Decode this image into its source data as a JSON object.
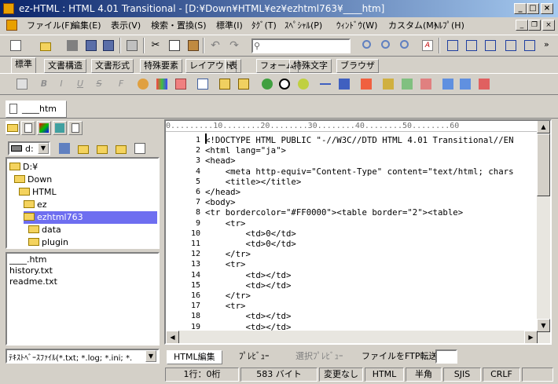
{
  "window": {
    "title": "ez-HTML : HTML 4.01 Transitional - [D:¥Down¥HTML¥ez¥ezhtml763¥____htm]",
    "controls": [
      "_",
      "□",
      "×"
    ]
  },
  "menu": {
    "items": [
      "ファイル(F)",
      "編集(E)",
      "表示(V)",
      "検索・置換(S)",
      "標準(I)",
      "ﾀｸﾞ(T)",
      "ｽﾍﾟｼｬﾙ(P)",
      "ｳｨﾝﾄﾞｳ(W)",
      "カスタム(M)",
      "ﾍﾙﾌﾟ(H)"
    ]
  },
  "toolbar": {
    "search_value": ""
  },
  "tag_tabs": [
    "標準",
    "文書構造",
    "文書形式",
    "特殊要素",
    "レイアウト",
    "表",
    "フォーム",
    "特殊文字",
    "ブラウザ"
  ],
  "document_tab": "____htm",
  "sidebar": {
    "drive": "d:",
    "tree": [
      "D:¥",
      "Down",
      "HTML",
      "ez",
      "ezhtml763",
      "data",
      "plugin"
    ],
    "files": [
      "____.htm",
      "history.txt",
      "readme.txt"
    ],
    "filter": "ﾃｷｽﾄﾍﾞｰｽﾌｧｲﾙ(*.txt; *.log; *.ini; *."
  },
  "editor": {
    "ruler": "0.........10........20........30........40........50........60",
    "line_numbers": [
      "1",
      "2",
      "3",
      "4",
      "5",
      "6",
      "7",
      "8",
      "9",
      "10",
      "11",
      "12",
      "13",
      "14",
      "15",
      "16",
      "17",
      "18",
      "19"
    ],
    "lines": [
      "<!DOCTYPE HTML PUBLIC \"-//W3C//DTD HTML 4.01 Transitional//EN",
      "<html lang=\"ja\">",
      "<head>",
      "    <meta http-equiv=\"Content-Type\" content=\"text/html; chars",
      "    <title></title>",
      "</head>",
      "<body>",
      "<tr bordercolor=\"#FF0000\"><table border=\"2\"><table>",
      "    <tr>",
      "        <td>0</td>",
      "        <td>0</td>",
      "    </tr>",
      "    <tr>",
      "        <td></td>",
      "        <td></td>",
      "    </tr>",
      "    <tr>",
      "        <td></td>",
      "        <td></td>"
    ]
  },
  "bottom_tabs": [
    "HTML編集",
    "ﾌﾟﾚﾋﾞｭｰ",
    "選択ﾌﾟﾚﾋﾞｭｰ",
    "ファイルをFTP転送"
  ],
  "status": {
    "position": "1行：0桁",
    "size": "583 バイト",
    "modified": "変更なし",
    "mode": "HTML",
    "width": "半角",
    "encoding": "SJIS",
    "newline": "CRLF"
  },
  "colors": {
    "titlebar_start": "#0a246a",
    "titlebar_end": "#a6caf0",
    "selection": "#6e6ef0"
  }
}
